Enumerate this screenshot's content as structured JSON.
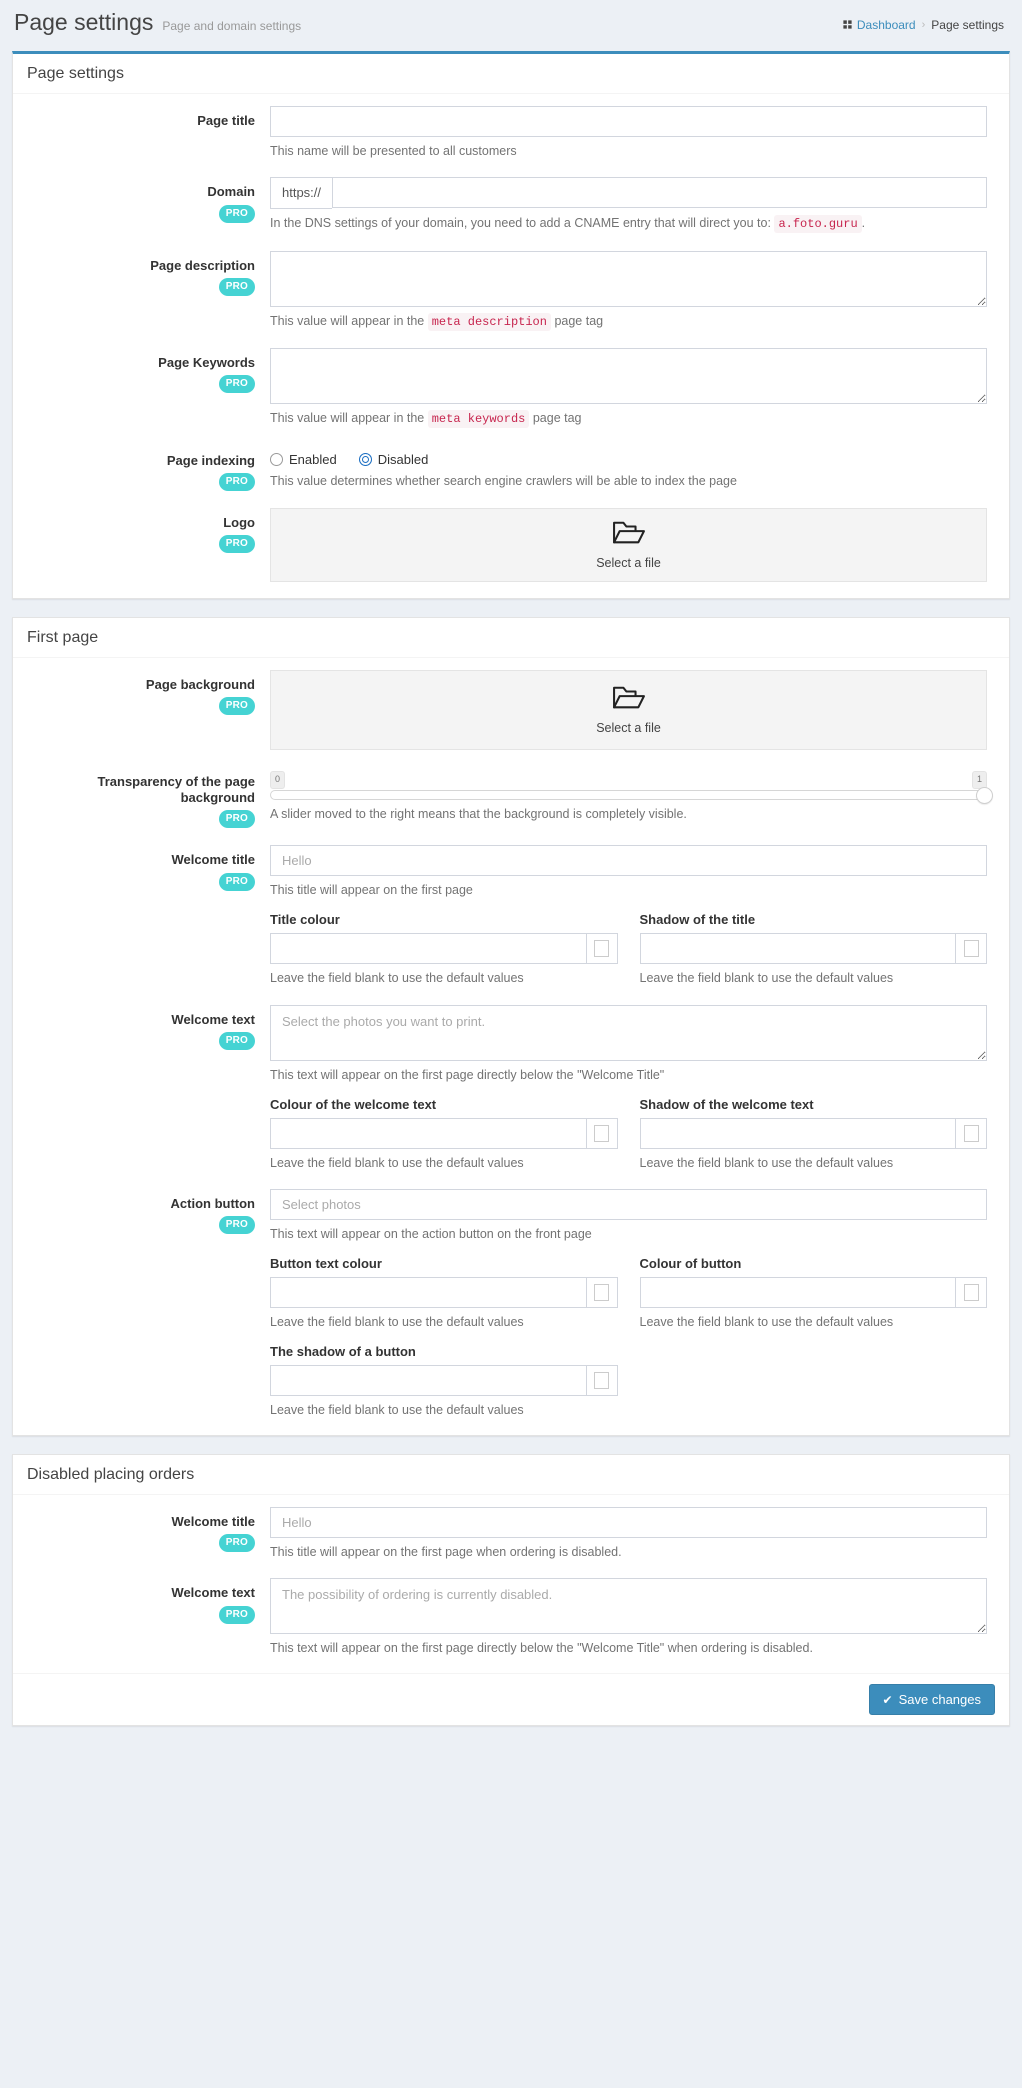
{
  "header": {
    "title": "Page settings",
    "subtitle": "Page and domain settings",
    "breadcrumb": {
      "dashboard": "Dashboard",
      "separator": "›",
      "current": "Page settings"
    }
  },
  "sections": {
    "page_settings": {
      "title": "Page settings",
      "fields": {
        "page_title": {
          "label": "Page title",
          "value": "",
          "placeholder": "",
          "help": "This name will be presented to all customers"
        },
        "domain": {
          "label": "Domain",
          "badge": "PRO",
          "addon": "https://",
          "value": "",
          "placeholder": "",
          "help_before": "In the DNS settings of your domain, you need to add a CNAME entry that will direct you to:",
          "help_code": "a.foto.guru",
          "help_after": "."
        },
        "page_description": {
          "label": "Page description",
          "badge": "PRO",
          "value": "",
          "placeholder": "",
          "help_before": "This value will appear in the",
          "help_code": "meta description",
          "help_after": "page tag"
        },
        "page_keywords": {
          "label": "Page Keywords",
          "badge": "PRO",
          "value": "",
          "placeholder": "",
          "help_before": "This value will appear in the",
          "help_code": "meta keywords",
          "help_after": "page tag"
        },
        "page_indexing": {
          "label": "Page indexing",
          "badge": "PRO",
          "options": [
            {
              "label": "Enabled",
              "checked": false
            },
            {
              "label": "Disabled",
              "checked": true
            }
          ],
          "help": "This value determines whether search engine crawlers will be able to index the page"
        },
        "logo": {
          "label": "Logo",
          "badge": "PRO",
          "dropzone_label": "Select a file",
          "icon": "open-folder-icon"
        }
      }
    },
    "first_page": {
      "title": "First page",
      "fields": {
        "page_background": {
          "label": "Page background",
          "badge": "PRO",
          "dropzone_label": "Select a file",
          "icon": "open-folder-icon"
        },
        "transparency": {
          "label": "Transparency of the page background",
          "badge": "PRO",
          "min_label": "0",
          "max_label": "1",
          "value": 1,
          "help": "A slider moved to the right means that the background is completely visible."
        },
        "welcome_title": {
          "label": "Welcome title",
          "badge": "PRO",
          "value": "",
          "placeholder": "Hello",
          "help": "This title will appear on the first page",
          "sub": [
            {
              "label": "Title colour",
              "value": "",
              "placeholder": "",
              "help": "Leave the field blank to use the default values",
              "swatch": "#ffffff"
            },
            {
              "label": "Shadow of the title",
              "value": "",
              "placeholder": "",
              "help": "Leave the field blank to use the default values",
              "swatch": "#ffffff"
            }
          ]
        },
        "welcome_text": {
          "label": "Welcome text",
          "badge": "PRO",
          "value": "",
          "placeholder": "Select the photos you want to print.",
          "help": "This text will appear on the first page directly below the \"Welcome Title\"",
          "sub": [
            {
              "label": "Colour of the welcome text",
              "value": "",
              "placeholder": "",
              "help": "Leave the field blank to use the default values",
              "swatch": "#ffffff"
            },
            {
              "label": "Shadow of the welcome text",
              "value": "",
              "placeholder": "",
              "help": "Leave the field blank to use the default values",
              "swatch": "#ffffff"
            }
          ]
        },
        "action_button": {
          "label": "Action button",
          "badge": "PRO",
          "value": "",
          "placeholder": "Select photos",
          "help": "This text will appear on the action button on the front page",
          "sub": [
            {
              "label": "Button text colour",
              "value": "",
              "placeholder": "",
              "help": "Leave the field blank to use the default values",
              "swatch": "#ffffff"
            },
            {
              "label": "Colour of button",
              "value": "",
              "placeholder": "",
              "help": "Leave the field blank to use the default values",
              "swatch": "#ffffff"
            }
          ],
          "sub2": [
            {
              "label": "The shadow of a button",
              "value": "",
              "placeholder": "",
              "help": "Leave the field blank to use the default values",
              "swatch": "#ffffff"
            }
          ]
        }
      }
    },
    "disabled_orders": {
      "title": "Disabled placing orders",
      "fields": {
        "welcome_title": {
          "label": "Welcome title",
          "badge": "PRO",
          "value": "",
          "placeholder": "Hello",
          "help": "This title will appear on the first page when ordering is disabled."
        },
        "welcome_text": {
          "label": "Welcome text",
          "badge": "PRO",
          "value": "",
          "placeholder": "The possibility of ordering is currently disabled.",
          "help": "This text will appear on the first page directly below the \"Welcome Title\" when ordering is disabled."
        }
      }
    }
  },
  "footer": {
    "save_label": "Save changes",
    "save_icon": "check-icon"
  },
  "colors": {
    "accent": "#3c8dbc",
    "pro_badge": "#45d3d3",
    "code_text": "#c7254e",
    "radio_checked": "#1b6ec2"
  }
}
